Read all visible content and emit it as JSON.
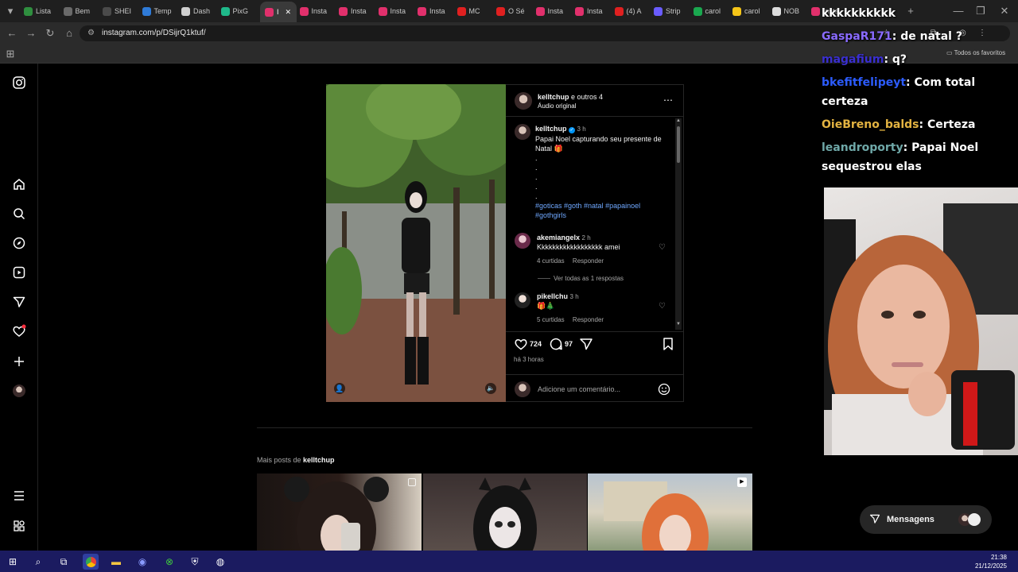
{
  "browser": {
    "tabs": [
      {
        "label": "Lista",
        "color": "#2f8f3f"
      },
      {
        "label": "Bem",
        "color": "#6a6a6a"
      },
      {
        "label": "SHEI",
        "color": "#4a4a4a"
      },
      {
        "label": "Temp",
        "color": "#2f7bd8"
      },
      {
        "label": "Dash",
        "color": "#d0d0d0"
      },
      {
        "label": "PixG",
        "color": "#1fb98a"
      },
      {
        "label": "I",
        "color": "#e1306c"
      },
      {
        "label": "Insta",
        "color": "#e1306c"
      },
      {
        "label": "Insta",
        "color": "#e1306c"
      },
      {
        "label": "Insta",
        "color": "#e1306c"
      },
      {
        "label": "Insta",
        "color": "#e1306c"
      },
      {
        "label": "MC",
        "color": "#e02020"
      },
      {
        "label": "O Sé",
        "color": "#e02020"
      },
      {
        "label": "Insta",
        "color": "#e1306c"
      },
      {
        "label": "Insta",
        "color": "#e1306c"
      },
      {
        "label": "(4) A",
        "color": "#e02020"
      },
      {
        "label": "Strip",
        "color": "#6a5cff"
      },
      {
        "label": "carol",
        "color": "#1aa84f"
      },
      {
        "label": "carol",
        "color": "#f5c518"
      },
      {
        "label": "NOB",
        "color": "#dcdcdc"
      },
      {
        "label": "Insta",
        "color": "#e1306c"
      }
    ],
    "url": "instagram.com/p/DSijrQ1ktuf/",
    "bookmarks_label": "Todos os favoritos"
  },
  "post": {
    "header_user": "kelltchup",
    "header_others": "e outros 4",
    "audio": "Áudio original",
    "caption_user": "kelltchup",
    "caption_time": "3 h",
    "caption_line1": "Papai Noel capturando seu presente de",
    "caption_line2": "Natal 🎁",
    "caption_dots": ".",
    "hashtags_line1": "#goticas #goth #natal #papainoel",
    "hashtags_line2": "#gothgirls",
    "comments": [
      {
        "user": "akemiangelx",
        "time": "2 h",
        "text": "Kkkkkkkkkkkkkkkkkk amei",
        "likes": "4 curtidas",
        "reply": "Responder",
        "view_replies": "Ver todas as 1 respostas"
      },
      {
        "user": "pikellchu",
        "time": "3 h",
        "text": "🎁🎄",
        "likes": "5 curtidas",
        "reply": "Responder"
      }
    ],
    "like_count": "724",
    "comment_count": "97",
    "posted": "há 3 horas",
    "comment_placeholder": "Adicione um comentário..."
  },
  "more": {
    "prefix": "Mais posts de",
    "user": "kelltchup"
  },
  "chat": [
    {
      "user": "",
      "text": "kkkkkkkkkk",
      "color": "#ffffff"
    },
    {
      "user": "GaspaR171",
      "text": ": de natal ?",
      "color": "#8a6bff"
    },
    {
      "user": "magafium",
      "text": ": q?",
      "color": "#3a2fd0"
    },
    {
      "user": "bkefitfelipeyt",
      "text": ": Com total",
      "color": "#2c5cff"
    },
    {
      "user": "",
      "text": "certeza",
      "color": "#ffffff"
    },
    {
      "user": "OieBreno_balds",
      "text": ": Certeza",
      "color": "#e3b341"
    },
    {
      "user": "leandroporty",
      "text": ": Papai Noel",
      "color": "#6fa8a8"
    },
    {
      "user": "",
      "text": "sequestrou elas",
      "color": "#ffffff"
    }
  ],
  "messages_label": "Mensagens",
  "taskbar": {
    "time": "21:38",
    "date": "21/12/2025"
  }
}
